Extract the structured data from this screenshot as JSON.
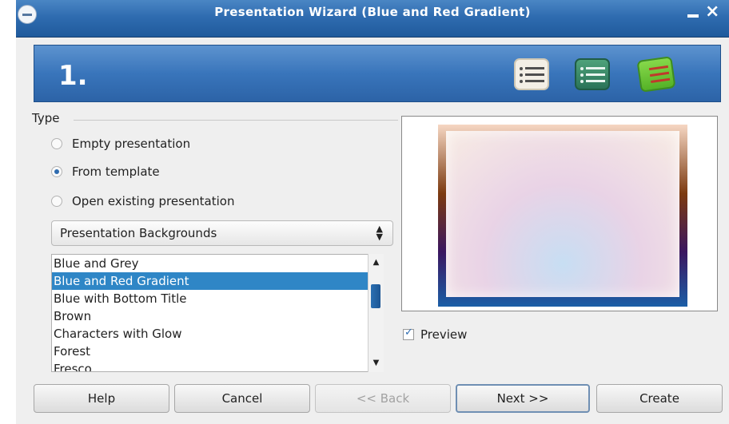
{
  "window": {
    "title": "Presentation Wizard (Blue and Red Gradient)"
  },
  "header": {
    "step": "1."
  },
  "type_section": {
    "label": "Type",
    "options": [
      {
        "label": "Empty presentation",
        "selected": false
      },
      {
        "label": "From template",
        "selected": true
      },
      {
        "label": "Open existing presentation",
        "selected": false
      }
    ]
  },
  "category": {
    "value": "Presentation Backgrounds"
  },
  "templates": {
    "items": [
      "Blue and Grey",
      "Blue and Red Gradient",
      "Blue with Bottom Title",
      "Brown",
      "Characters with Glow",
      "Forest",
      "Fresco"
    ],
    "selected_index": 1
  },
  "preview": {
    "label": "Preview",
    "checked": true
  },
  "buttons": {
    "help": "Help",
    "cancel": "Cancel",
    "back": "<< Back",
    "next": "Next >>",
    "create": "Create"
  },
  "colors": {
    "titlebar": "#2f6cb0",
    "header": "#3975bb",
    "selection": "#2f86c6"
  }
}
